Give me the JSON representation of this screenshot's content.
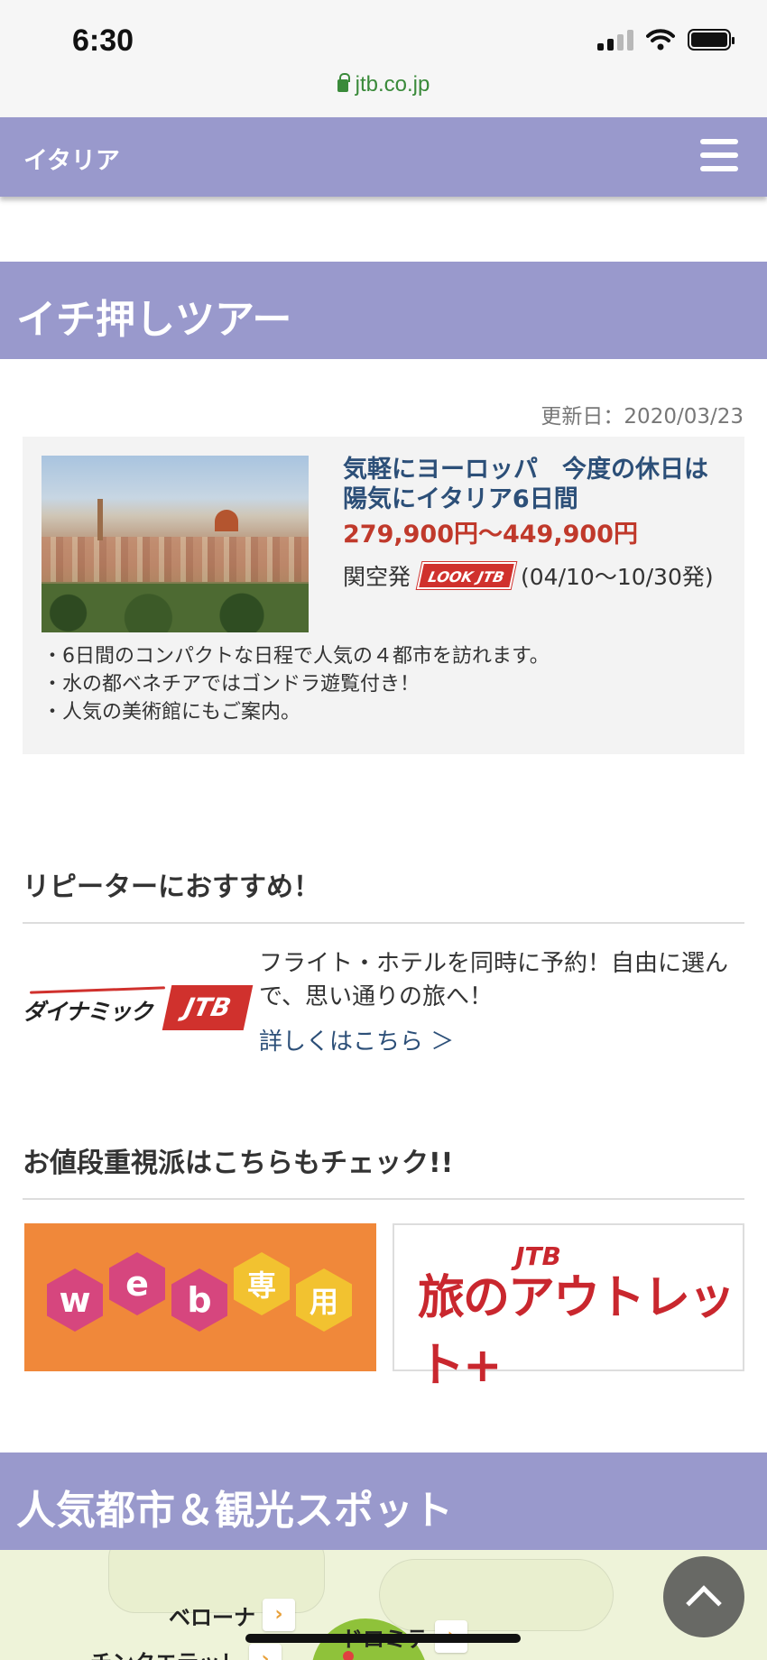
{
  "status_bar": {
    "time": "6:30"
  },
  "browser": {
    "url": "jtb.co.jp"
  },
  "header": {
    "title": "イタリア"
  },
  "featured": {
    "section_title": "イチ押しツアー",
    "updated": "更新日：2020/03/23",
    "tour": {
      "title": "気軽にヨーロッパ　今度の休日は陽気にイタリア6日間",
      "price": "279,900円〜449,900円",
      "departure": "関空発",
      "brand_logo": "LOOK JTB",
      "period": "(04/10〜10/30発)",
      "points": [
        "・6日間のコンパクトな日程で人気の４都市を訪れます。",
        "・水の都ベネチアではゴンドラ遊覧付き！",
        "・人気の美術館にもご案内。"
      ]
    }
  },
  "repeater": {
    "heading": "リピーターにおすすめ！",
    "logo_text": "ダイナミック",
    "logo_jtb": "JTB",
    "description": "フライト・ホテルを同時に予約！自由に選んで、思い通りの旅へ！",
    "link": "詳しくはこちら ＞"
  },
  "value": {
    "heading": "お値段重視派はこちらもチェック!!",
    "web_banner": [
      "w",
      "e",
      "b",
      "専",
      "用"
    ],
    "outlet_banner": {
      "jtb": "JTB",
      "text": "旅のアウトレット+"
    }
  },
  "spots": {
    "section_title": "人気都市＆観光スポット",
    "labels": [
      "ベローナ",
      "ドロミテ",
      "チンクエテッレ"
    ],
    "arrow": "›"
  },
  "colors": {
    "accent": "#9999cc",
    "title_blue": "#2c4f78",
    "price_red": "#c0392b",
    "web_orange": "#f0883a"
  }
}
